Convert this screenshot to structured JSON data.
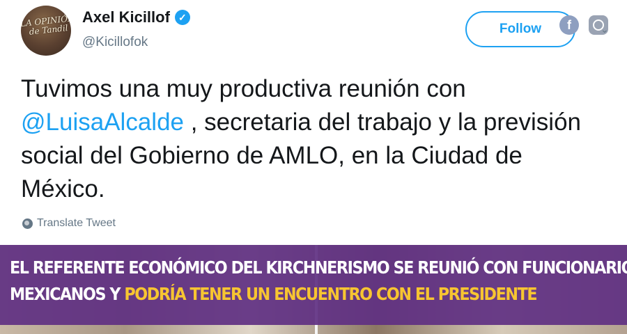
{
  "tweet": {
    "avatar_text": "LA OPINIÓN de Tandil",
    "display_name": "Axel Kicillof",
    "verified": "✓",
    "handle": "@Kicillofok",
    "follow_label": "Follow",
    "text_part1": "Tuvimos una muy productiva reunión con",
    "mention": "@LuisaAlcalde",
    "text_part2": " , secretaria del trabajo y la previsión social del Gobierno de AMLO, en la Ciudad de México.",
    "translate_label": "Translate Tweet"
  },
  "share": {
    "facebook_glyph": "f",
    "facebook_icon": "facebook-icon",
    "instagram_icon": "instagram-icon"
  },
  "banner": {
    "line1": "EL REFERENTE ECONÓMICO DEL KIRCHNERISMO SE REUNIÓ CON FUNCIONARIOS",
    "line2_white": "MEXICANOS Y ",
    "line2_accent": "PODRÍA TENER UN ENCUENTRO CON EL PRESIDENTE"
  },
  "colors": {
    "accent": "#1da1f2",
    "banner_bg": "#603082",
    "banner_highlight": "#f7c531"
  }
}
